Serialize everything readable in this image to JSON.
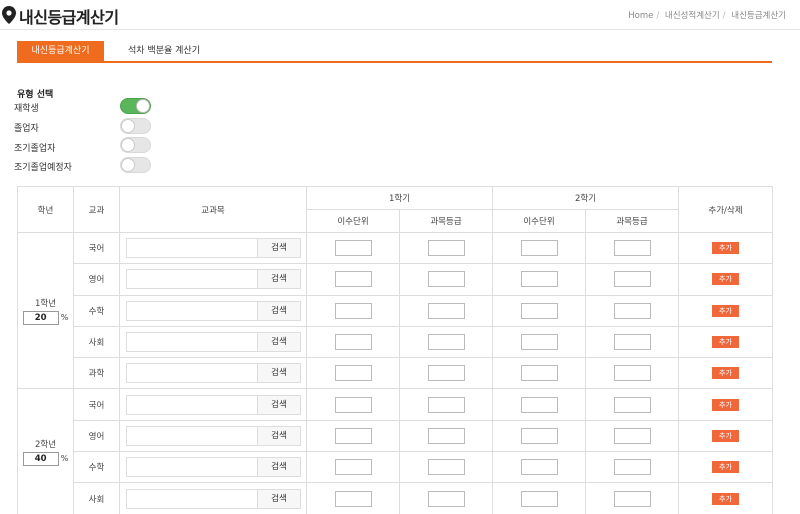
{
  "header": {
    "title": "내신등급계산기",
    "breadcrumb": [
      "Home",
      "내신성적계산기",
      "내신등급계산기"
    ]
  },
  "tabs": [
    {
      "label": "내신등급계산기",
      "active": true
    },
    {
      "label": "석차 백분율 계산기",
      "active": false
    }
  ],
  "type_select": {
    "title": "유형 선택",
    "options": [
      {
        "label": "재학생",
        "on": true
      },
      {
        "label": "졸업자",
        "on": false
      },
      {
        "label": "조기졸업자",
        "on": false
      },
      {
        "label": "조기졸업예정자",
        "on": false
      }
    ]
  },
  "table": {
    "headers": {
      "grade": "학년",
      "subject_group": "교과",
      "subject": "교과목",
      "sem1": "1학기",
      "sem2": "2학기",
      "units": "이수단위",
      "course_grade": "과목등급",
      "action": "추가/삭제"
    },
    "search_label": "검색",
    "add_label": "추가",
    "pct_sign": "%",
    "groups": [
      {
        "grade_label": "1학년",
        "weight": "20",
        "subjects": [
          "국어",
          "영어",
          "수학",
          "사회",
          "과학"
        ]
      },
      {
        "grade_label": "2학년",
        "weight": "40",
        "subjects": [
          "국어",
          "영어",
          "수학",
          "사회"
        ]
      }
    ]
  },
  "colors": {
    "accent": "#ef6c1f",
    "toggle_on": "#5bb55a",
    "add_button": "#f0683a"
  }
}
